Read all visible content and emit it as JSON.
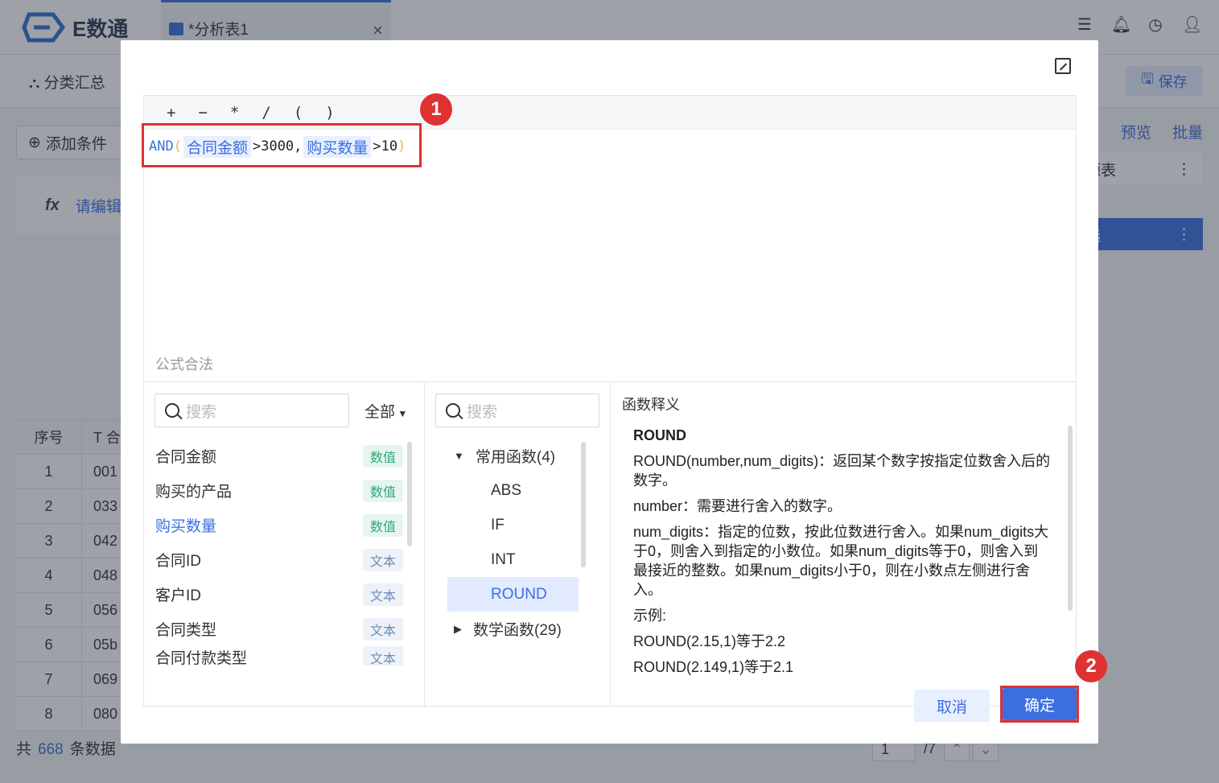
{
  "app": {
    "logo_text": "E数通",
    "tab_title": "*分析表1",
    "tab_close": "×",
    "toolbar_left": "分类汇总",
    "save_label": "保存",
    "add_condition": "添加条件",
    "fx_label": "fx",
    "fx_hint": "请编辑",
    "link_preview": "预览",
    "link_batch": "批量",
    "src_table_label": "源表",
    "select_label": "选",
    "more_icon": "⋮",
    "grid_header_index": "序号",
    "grid_header_col": "T 合",
    "grid_rows": [
      {
        "idx": "1",
        "val": "001"
      },
      {
        "idx": "2",
        "val": "033"
      },
      {
        "idx": "3",
        "val": "042"
      },
      {
        "idx": "4",
        "val": "048"
      },
      {
        "idx": "5",
        "val": "056"
      },
      {
        "idx": "6",
        "val": "05b"
      },
      {
        "idx": "7",
        "val": "069"
      },
      {
        "idx": "8",
        "val": "080"
      }
    ],
    "footer_prefix": "共",
    "footer_count": "668",
    "footer_suffix": "条数据",
    "pager_page": "1",
    "pager_total": "/7"
  },
  "dialog": {
    "ops": [
      "+",
      "−",
      "*",
      "/",
      "(",
      ")"
    ],
    "formula": {
      "func": "AND",
      "open": "(",
      "field1": "合同金额",
      "cmp1": ">3000,",
      "field2": "购买数量",
      "cmp2": ">10",
      "close": ")"
    },
    "status": "公式合法",
    "field_search_placeholder": "搜索",
    "field_filter": "全部",
    "fields": [
      {
        "name": "合同金额",
        "type": "数值"
      },
      {
        "name": "购买的产品",
        "type": "数值"
      },
      {
        "name": "购买数量",
        "type": "数值"
      },
      {
        "name": "合同ID",
        "type": "文本"
      },
      {
        "name": "客户ID",
        "type": "文本"
      },
      {
        "name": "合同类型",
        "type": "文本"
      },
      {
        "name": "合同付款类型",
        "type": "文本"
      }
    ],
    "fn_search_placeholder": "搜索",
    "fn_group_common": "常用函数(4)",
    "fn_items": [
      "ABS",
      "IF",
      "INT",
      "ROUND"
    ],
    "fn_group_math": "数学函数(29)",
    "desc_title": "函数释义",
    "desc": {
      "name": "ROUND",
      "p1": "ROUND(number,num_digits)：返回某个数字按指定位数舍入后的数字。",
      "p2": "number：需要进行舍入的数字。",
      "p3": "num_digits：指定的位数，按此位数进行舍入。如果num_digits大于0，则舍入到指定的小数位。如果num_digits等于0，则舍入到最接近的整数。如果num_digits小于0，则在小数点左侧进行舍入。",
      "p4": "示例:",
      "p5": "ROUND(2.15,1)等于2.2",
      "p6": "ROUND(2.149,1)等于2.1"
    },
    "cancel_label": "取消",
    "ok_label": "确定",
    "badge1": "1",
    "badge2": "2"
  },
  "colors": {
    "accent": "#3b6fe0",
    "highlight": "#e03131"
  }
}
